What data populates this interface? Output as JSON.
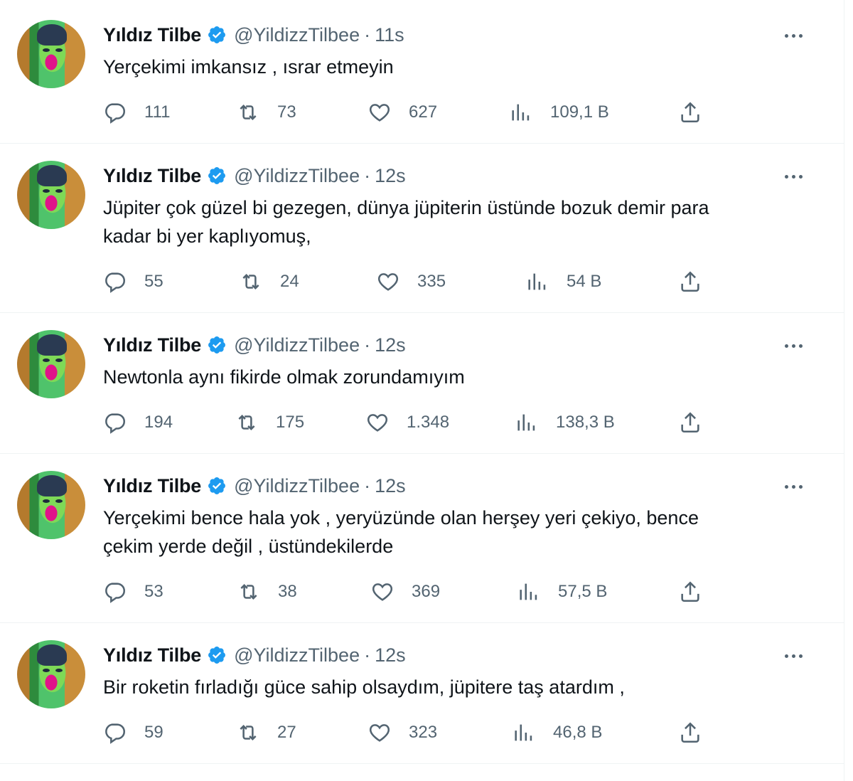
{
  "colors": {
    "text": "#0f1419",
    "muted": "#536471",
    "verified": "#1d9bf0",
    "divider": "#eff3f4"
  },
  "icons": {
    "reply": "reply-icon",
    "retweet": "retweet-icon",
    "like": "heart-icon",
    "views": "views-icon",
    "share": "share-icon",
    "more": "more-icon",
    "verified": "verified-badge-icon"
  },
  "tweets": [
    {
      "name": "Yıldız Tilbe",
      "handle": "@YildizzTilbee",
      "separator": "·",
      "time": "11s",
      "text": "Yerçekimi imkansız , ısrar etmeyin",
      "replies": "111",
      "retweets": "73",
      "likes": "627",
      "views": "109,1 B"
    },
    {
      "name": "Yıldız Tilbe",
      "handle": "@YildizzTilbee",
      "separator": "·",
      "time": "12s",
      "text": "Jüpiter çok güzel bi gezegen, dünya jüpiterin üstünde  bozuk demir para\nkadar bi yer kaplıyomuş,",
      "replies": "55",
      "retweets": "24",
      "likes": "335",
      "views": "54 B"
    },
    {
      "name": "Yıldız Tilbe",
      "handle": "@YildizzTilbee",
      "separator": "·",
      "time": "12s",
      "text": "Newtonla aynı fikirde olmak zorundamıyım",
      "replies": "194",
      "retweets": "175",
      "likes": "1.348",
      "views": "138,3 B"
    },
    {
      "name": "Yıldız Tilbe",
      "handle": "@YildizzTilbee",
      "separator": "·",
      "time": "12s",
      "text": "Yerçekimi bence hala  yok , yeryüzünde olan herşey yeri çekiyo, bence\nçekim yerde değil , üstündekilerde",
      "replies": "53",
      "retweets": "38",
      "likes": "369",
      "views": "57,5 B"
    },
    {
      "name": "Yıldız Tilbe",
      "handle": "@YildizzTilbee",
      "separator": "·",
      "time": "12s",
      "text": "Bir roketin fırladığı güce sahip olsaydım, jüpitere taş atardım ,",
      "replies": "59",
      "retweets": "27",
      "likes": "323",
      "views": "46,8 B"
    }
  ]
}
